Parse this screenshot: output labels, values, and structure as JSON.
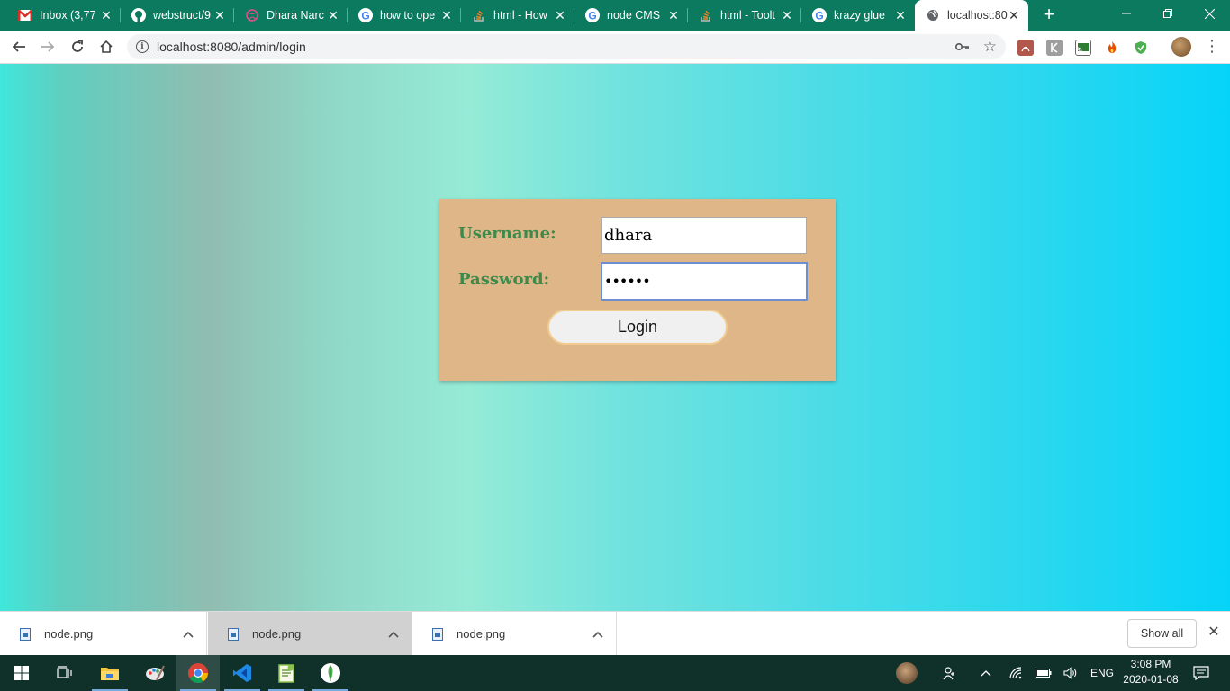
{
  "browser": {
    "tabs": [
      {
        "title": "Inbox (3,77",
        "favicon": "gmail-icon"
      },
      {
        "title": "webstruct/9",
        "favicon": "github-icon"
      },
      {
        "title": "Dhara Narc",
        "favicon": "dribbble-icon"
      },
      {
        "title": "how to ope",
        "favicon": "google-icon"
      },
      {
        "title": "html - How",
        "favicon": "stackoverflow-icon"
      },
      {
        "title": "node CMS",
        "favicon": "google-icon"
      },
      {
        "title": "html - Toolt",
        "favicon": "stackoverflow-icon"
      },
      {
        "title": "krazy glue",
        "favicon": "google-icon"
      },
      {
        "title": "localhost:80",
        "favicon": "globe-icon",
        "active": true
      }
    ],
    "new_tab": "+",
    "address": "localhost:8080/admin/login",
    "colors": {
      "tabstrip": "#0b7a5f"
    }
  },
  "login": {
    "username_label": "Username:",
    "username_value": "dhara",
    "password_label": "Password:",
    "password_value": "••••••",
    "login_button": "Login"
  },
  "downloads": {
    "items": [
      {
        "name": "node.png"
      },
      {
        "name": "node.png"
      },
      {
        "name": "node.png"
      }
    ],
    "show_all": "Show all"
  },
  "taskbar": {
    "language": "ENG",
    "time": "3:08 PM",
    "date": "2020-01-08"
  }
}
